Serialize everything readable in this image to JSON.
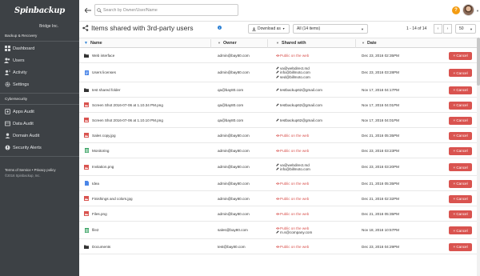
{
  "sidebar": {
    "logo": "Spinbackup",
    "org": "Bridge Inc.",
    "section_backup": "Backup & Recovery",
    "backup_items": [
      {
        "label": "Dashboard",
        "icon": "dashboard-icon"
      },
      {
        "label": "Users",
        "icon": "users-icon"
      },
      {
        "label": "Activity",
        "icon": "activity-icon"
      },
      {
        "label": "Settings",
        "icon": "gear-icon"
      }
    ],
    "section_security": "Cybersecurity",
    "security_items": [
      {
        "label": "Apps Audit",
        "icon": "apps-icon"
      },
      {
        "label": "Data Audit",
        "icon": "data-icon"
      },
      {
        "label": "Domain Audit",
        "icon": "domain-icon"
      },
      {
        "label": "Security Alerts",
        "icon": "alert-icon"
      }
    ],
    "footer_links": "Terms of Service • Privacy policy",
    "footer_copy": "©2016 Spinbackup, Inc."
  },
  "topbar": {
    "search_placeholder": "Search by Owner/User/Name",
    "help": "?"
  },
  "titlebar": {
    "title": "Items shared with 3rd-party users",
    "download_label": "Download as",
    "filter_value": "All (14 items)",
    "pager_text": "1 - 14 of 14",
    "per_page": "50"
  },
  "table": {
    "headers": {
      "name": "Name",
      "owner": "Owner",
      "shared_with": "Shared with",
      "date": "Date"
    },
    "cancel_label": "× Cancel",
    "rows": [
      {
        "name": "Web interface",
        "type": "folder",
        "owner": "admin@bay80.com",
        "shared": [
          {
            "text": "Public on the web",
            "public": true
          }
        ],
        "date": "Dec 23, 2016 02:35PM"
      },
      {
        "name": "Users licenses",
        "type": "doc",
        "owner": "admin@bay80.com",
        "shared": [
          {
            "text": "va@webdirect.md",
            "public": false
          },
          {
            "text": "info@billmoto.com",
            "public": false
          },
          {
            "text": "sed@billmoto.com",
            "public": false
          }
        ],
        "date": "Dec 23, 2016 03:28PM"
      },
      {
        "name": "test shared folder",
        "type": "folder",
        "owner": "qa@bay80.com",
        "shared": [
          {
            "text": "testbackup62@gmail.com",
            "public": false
          }
        ],
        "date": "Nov 17, 2016 04:17PM"
      },
      {
        "name": "Screen Shot 2016-07-06 at 1.10.34 PM.png",
        "type": "image",
        "owner": "qa@bay80.com",
        "shared": [
          {
            "text": "testbackup62@gmail.com",
            "public": false
          }
        ],
        "date": "Nov 17, 2016 04:01PM"
      },
      {
        "name": "Screen Shot 2016-07-06 at 1.10.10 PM.png",
        "type": "image",
        "owner": "qa@bay80.com",
        "shared": [
          {
            "text": "testbackup62@gmail.com",
            "public": false
          }
        ],
        "date": "Nov 17, 2016 04:01PM"
      },
      {
        "name": "Sales copy.jpg",
        "type": "image",
        "owner": "admin@bay80.com",
        "shared": [
          {
            "text": "Public on the web",
            "public": true
          }
        ],
        "date": "Dec 21, 2016 05:35PM"
      },
      {
        "name": "Monitoring",
        "type": "sheet",
        "owner": "admin@bay80.com",
        "shared": [
          {
            "text": "Public on the web",
            "public": true
          }
        ],
        "date": "Dec 23, 2016 03:23PM"
      },
      {
        "name": "Invitation.png",
        "type": "image",
        "owner": "admin@bay80.com",
        "shared": [
          {
            "text": "va@webdirect.md",
            "public": false
          },
          {
            "text": "info@billmoto.com",
            "public": false
          }
        ],
        "date": "Dec 23, 2016 03:20PM"
      },
      {
        "name": "Idea",
        "type": "doc-blue",
        "owner": "admin@bay80.com",
        "shared": [
          {
            "text": "Public on the web",
            "public": true
          }
        ],
        "date": "Dec 21, 2016 05:35PM"
      },
      {
        "name": "Finishings and colors.jpg",
        "type": "image",
        "owner": "admin@bay80.com",
        "shared": [
          {
            "text": "Public on the web",
            "public": true
          }
        ],
        "date": "Dec 21, 2016 02:32PM"
      },
      {
        "name": "Files.png",
        "type": "image",
        "owner": "admin@bay80.com",
        "shared": [
          {
            "text": "Public on the web",
            "public": true
          }
        ],
        "date": "Dec 21, 2016 05:35PM"
      },
      {
        "name": "file2",
        "type": "sheet",
        "owner": "sales@bay80.com",
        "shared": [
          {
            "text": "Public on the web",
            "public": true
          },
          {
            "text": "m.s@company.com",
            "public": false
          }
        ],
        "date": "Nov 18, 2016 10:57PM"
      },
      {
        "name": "Documents",
        "type": "folder",
        "owner": "test@bay80.com",
        "shared": [
          {
            "text": "Public on the web",
            "public": true
          }
        ],
        "date": "Dec 23, 2016 04:29PM"
      }
    ]
  },
  "colors": {
    "sidebar_bg": "#3d4145",
    "cancel": "#d9534f",
    "public": "#d9534f",
    "accent": "#2a7fd4",
    "help": "#f39c12"
  }
}
